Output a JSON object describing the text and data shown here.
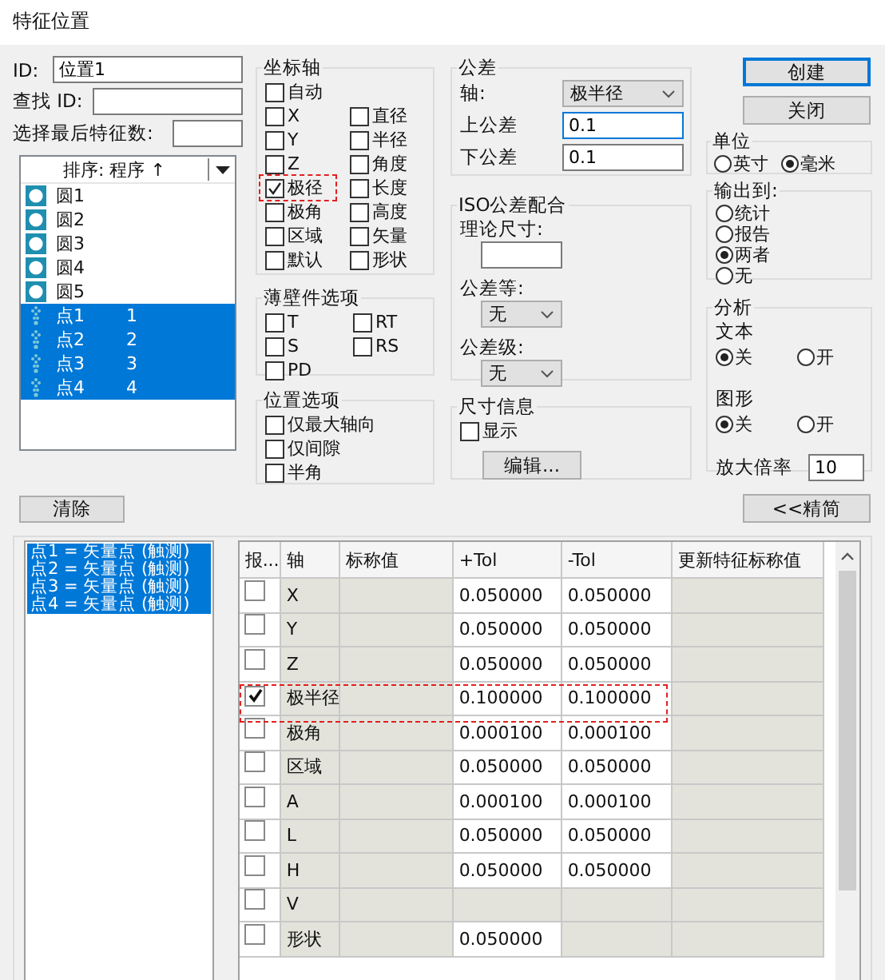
{
  "window": {
    "title": "特征位置"
  },
  "id_field": {
    "label": "ID:",
    "value": "位置1"
  },
  "find_id": {
    "label": "查找 ID:"
  },
  "select_last": {
    "label": "选择最后特征数:"
  },
  "feature_list": {
    "sort_label": "排序: 程序 ↑",
    "items": [
      {
        "kind": "circle",
        "name": "圆1",
        "selected": false
      },
      {
        "kind": "circle",
        "name": "圆2",
        "selected": false
      },
      {
        "kind": "circle",
        "name": "圆3",
        "selected": false
      },
      {
        "kind": "circle",
        "name": "圆4",
        "selected": false
      },
      {
        "kind": "circle",
        "name": "圆5",
        "selected": false
      },
      {
        "kind": "point",
        "name": "点1",
        "number": "1",
        "selected": true
      },
      {
        "kind": "point",
        "name": "点2",
        "number": "2",
        "selected": true
      },
      {
        "kind": "point",
        "name": "点3",
        "number": "3",
        "selected": true
      },
      {
        "kind": "point",
        "name": "点4",
        "number": "4",
        "selected": true
      }
    ]
  },
  "clear_button": "清除",
  "coordinate_axes": {
    "title": "坐标轴",
    "columns": [
      [
        {
          "label": "自动",
          "checked": false,
          "highlighted": false
        },
        {
          "label": "X",
          "checked": false,
          "highlighted": false
        },
        {
          "label": "Y",
          "checked": false,
          "highlighted": false
        },
        {
          "label": "Z",
          "checked": false,
          "highlighted": false
        },
        {
          "label": "极径",
          "checked": true,
          "highlighted": true
        },
        {
          "label": "极角",
          "checked": false,
          "highlighted": false
        },
        {
          "label": "区域",
          "checked": false,
          "highlighted": false
        },
        {
          "label": "默认",
          "checked": false,
          "highlighted": false
        }
      ],
      [
        {
          "label": "直径",
          "checked": false,
          "highlighted": false
        },
        {
          "label": "半径",
          "checked": false,
          "highlighted": false
        },
        {
          "label": "角度",
          "checked": false,
          "highlighted": false
        },
        {
          "label": "长度",
          "checked": false,
          "highlighted": false
        },
        {
          "label": "高度",
          "checked": false,
          "highlighted": false
        },
        {
          "label": "矢量",
          "checked": false,
          "highlighted": false
        },
        {
          "label": "形状",
          "checked": false,
          "highlighted": false
        }
      ]
    ]
  },
  "thin_wall_options": {
    "title": "薄壁件选项",
    "items": [
      {
        "label": "T",
        "checked": false
      },
      {
        "label": "RT",
        "checked": false
      },
      {
        "label": "S",
        "checked": false
      },
      {
        "label": "RS",
        "checked": false
      },
      {
        "label": "PD",
        "checked": false
      }
    ]
  },
  "position_options": {
    "title": "位置选项",
    "items": [
      {
        "label": "仅最大轴向",
        "checked": false
      },
      {
        "label": "仅间隙",
        "checked": false
      },
      {
        "label": "半角",
        "checked": false
      }
    ]
  },
  "tolerance": {
    "title": "公差",
    "axis_label": "轴:",
    "axis_value": "极半径",
    "upper_label": "上公差",
    "upper_value": "0.1",
    "lower_label": "下公差",
    "lower_value": "0.1"
  },
  "iso_fit": {
    "title": "ISO公差配合",
    "nominal_label": "理论尺寸:",
    "grade_label": "公差等:",
    "grade_value": "无",
    "class_label": "公差级:",
    "class_value": "无"
  },
  "dimension_info": {
    "title": "尺寸信息",
    "show": {
      "label": "显示",
      "checked": false
    },
    "edit_button": "编辑..."
  },
  "buttons": {
    "create": "创建",
    "close": "关闭",
    "less": "<<精简"
  },
  "units": {
    "title": "单位",
    "options": [
      {
        "label": "英寸",
        "selected": false
      },
      {
        "label": "毫米",
        "selected": true
      }
    ]
  },
  "output_to": {
    "title": "输出到:",
    "options": [
      {
        "label": "统计",
        "selected": false
      },
      {
        "label": "报告",
        "selected": false
      },
      {
        "label": "两者",
        "selected": true
      },
      {
        "label": "无",
        "selected": false
      }
    ]
  },
  "analysis": {
    "title": "分析",
    "text_label": "文本",
    "text_options": [
      {
        "label": "关",
        "selected": true
      },
      {
        "label": "开",
        "selected": false
      }
    ],
    "graphics_label": "图形",
    "graphics_options": [
      {
        "label": "关",
        "selected": true
      },
      {
        "label": "开",
        "selected": false
      }
    ],
    "magnify_label": "放大倍率",
    "magnify_value": "10"
  },
  "result_list": [
    {
      "text": "点1 = 矢量点 (触测)",
      "selected": true
    },
    {
      "text": "点2 = 矢量点 (触测)",
      "selected": true
    },
    {
      "text": "点3 = 矢量点 (触测)",
      "selected": true
    },
    {
      "text": "点4 = 矢量点 (触测)",
      "selected": true
    }
  ],
  "table": {
    "columns": [
      "报...",
      "轴",
      "标称值",
      "+Tol",
      "-Tol",
      "更新特征标称值"
    ],
    "rows": [
      {
        "report": false,
        "axis": "X",
        "plus_tol": "0.050000",
        "minus_tol": "0.050000",
        "highlighted": false
      },
      {
        "report": false,
        "axis": "Y",
        "plus_tol": "0.050000",
        "minus_tol": "0.050000",
        "highlighted": false
      },
      {
        "report": false,
        "axis": "Z",
        "plus_tol": "0.050000",
        "minus_tol": "0.050000",
        "highlighted": false
      },
      {
        "report": true,
        "axis": "极半径",
        "plus_tol": "0.100000",
        "minus_tol": "0.100000",
        "highlighted": true
      },
      {
        "report": false,
        "axis": "极角",
        "plus_tol": "0.000100",
        "minus_tol": "0.000100",
        "highlighted": false
      },
      {
        "report": false,
        "axis": "区域",
        "plus_tol": "0.050000",
        "minus_tol": "0.050000",
        "highlighted": false
      },
      {
        "report": false,
        "axis": "A",
        "plus_tol": "0.000100",
        "minus_tol": "0.000100",
        "highlighted": false
      },
      {
        "report": false,
        "axis": "L",
        "plus_tol": "0.050000",
        "minus_tol": "0.050000",
        "highlighted": false
      },
      {
        "report": false,
        "axis": "H",
        "plus_tol": "0.050000",
        "minus_tol": "0.050000",
        "highlighted": false
      },
      {
        "report": false,
        "axis": "V",
        "highlighted": false
      },
      {
        "report": false,
        "axis": "形状",
        "plus_tol": "0.050000",
        "highlighted": false
      }
    ]
  }
}
